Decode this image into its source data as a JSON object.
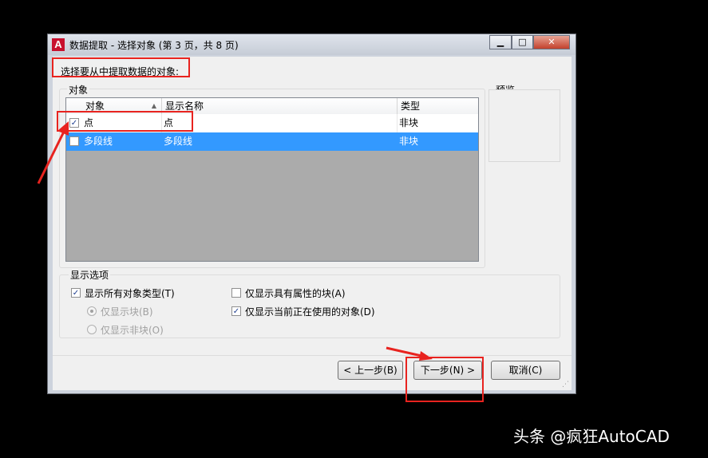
{
  "window": {
    "app_icon_letter": "A",
    "title": "数据提取 - 选择对象 (第 3 页，共 8 页)",
    "min_glyph": "▁",
    "max_glyph": "□",
    "close_glyph": "✕"
  },
  "prompt": "选择要从中提取数据的对象:",
  "objects_group": {
    "label": "对象",
    "columns": [
      "对象",
      "显示名称",
      "类型"
    ],
    "sort_glyph": "▲",
    "rows": [
      {
        "object": "点",
        "display_name": "点",
        "type": "非块",
        "checked": true,
        "selected": false
      },
      {
        "object": "多段线",
        "display_name": "多段线",
        "type": "非块",
        "checked": false,
        "selected": true
      }
    ]
  },
  "preview": {
    "label": "预览"
  },
  "display_options": {
    "label": "显示选项",
    "show_all_types": {
      "label": "显示所有对象类型(T)",
      "checked": true
    },
    "blocks_only": {
      "label": "仅显示块(B)",
      "selected": true,
      "enabled": false
    },
    "non_blocks_only": {
      "label": "仅显示非块(O)",
      "selected": false,
      "enabled": false
    },
    "attr_blocks_only": {
      "label": "仅显示具有属性的块(A)",
      "checked": false
    },
    "in_use_only": {
      "label": "仅显示当前正在使用的对象(D)",
      "checked": true
    }
  },
  "buttons": {
    "back": "< 上一步(B)",
    "next": "下一步(N) >",
    "cancel": "取消(C)"
  },
  "watermark": "头条 @疯狂AutoCAD",
  "colors": {
    "highlight_red": "#e8231f",
    "selection_blue": "#3399ff",
    "listview_bg": "#ababab"
  }
}
